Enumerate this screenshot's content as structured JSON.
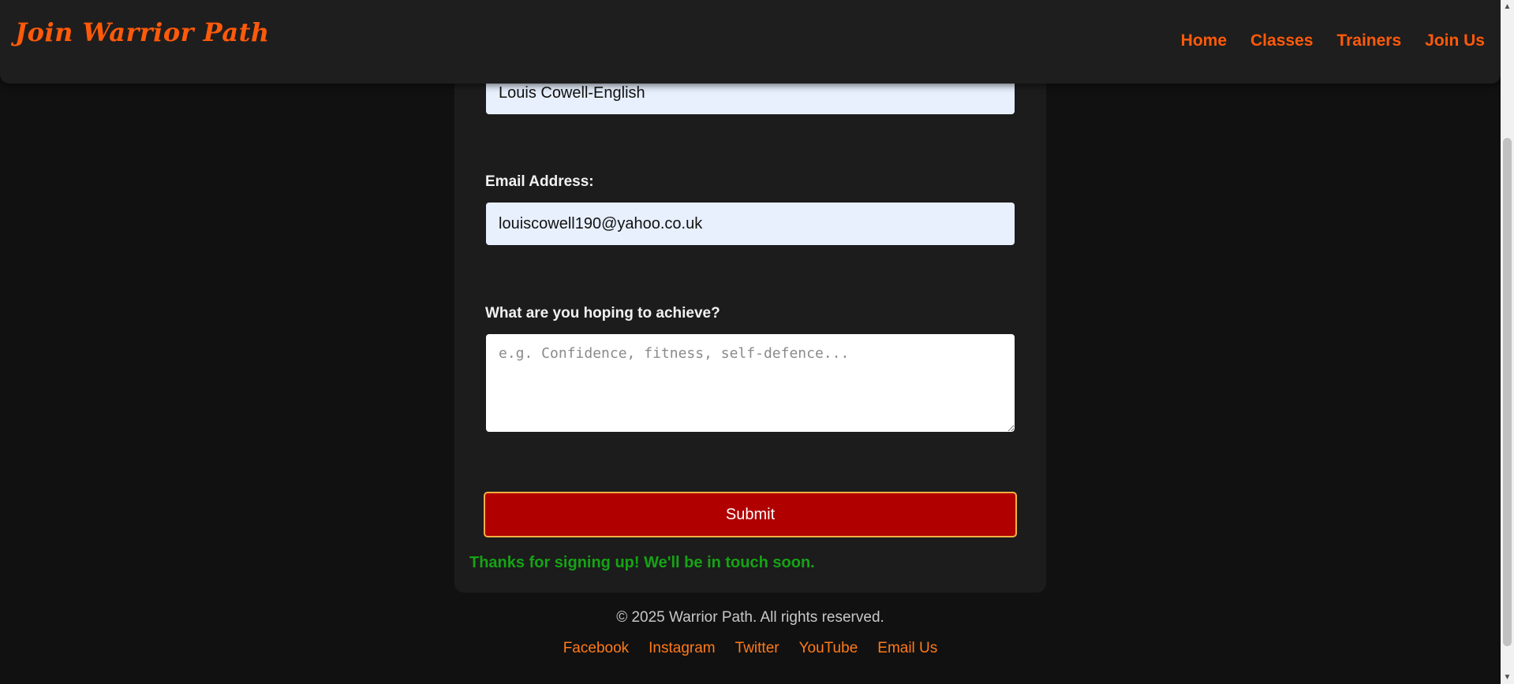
{
  "header": {
    "brand": "Join Warrior Path",
    "nav": [
      "Home",
      "Classes",
      "Trainers",
      "Join Us"
    ],
    "accent_color": "#ff5a0a"
  },
  "form": {
    "name_value": "Louis Cowell-English",
    "email_label": "Email Address:",
    "email_value": "louiscowell190@yahoo.co.uk",
    "goals_label": "What are you hoping to achieve?",
    "goals_placeholder": "e.g. Confidence, fitness, self-defence...",
    "submit_label": "Submit",
    "success_message": "Thanks for signing up! We'll be in touch soon.",
    "submit_color": "#b00000",
    "success_color": "#15a315"
  },
  "footer": {
    "copyright": "© 2025 Warrior Path. All rights reserved.",
    "links": [
      "Facebook",
      "Instagram",
      "Twitter",
      "YouTube",
      "Email Us"
    ]
  },
  "scrollbar": {
    "up_icon": "triangle-up-icon",
    "down_icon": "triangle-down-icon"
  }
}
